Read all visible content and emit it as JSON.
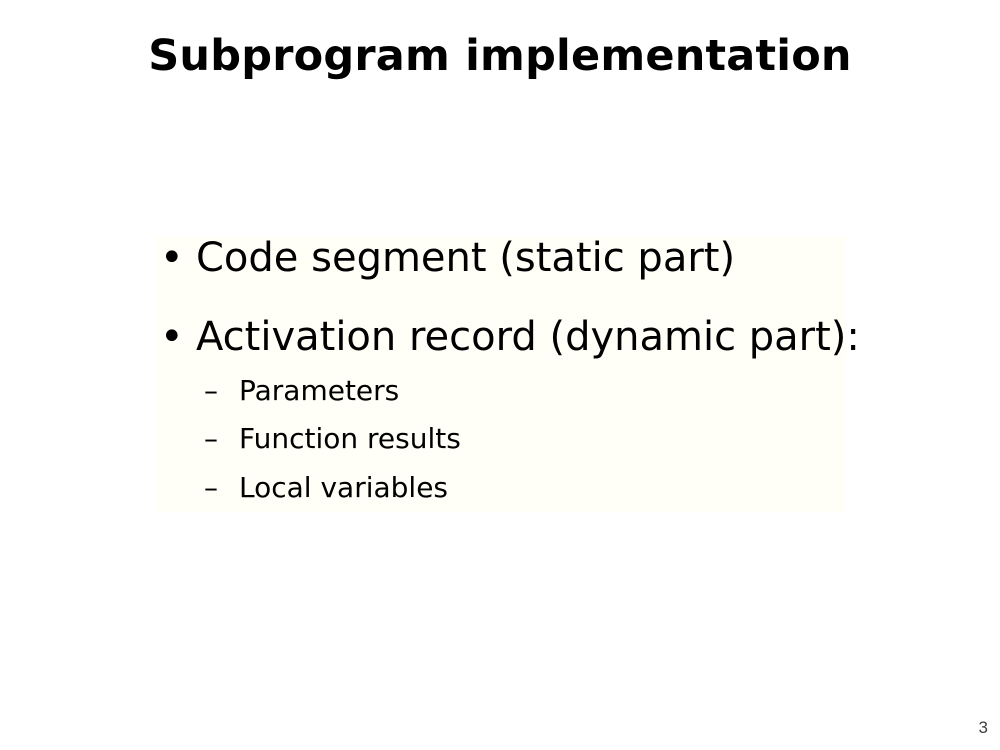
{
  "slide": {
    "title": "Subprogram implementation",
    "bullets": [
      {
        "marker": "•",
        "text": "Code segment (static part)"
      },
      {
        "marker": "•",
        "text": "Activation record (dynamic part):"
      }
    ],
    "subitems": [
      {
        "marker": "–",
        "text": "Parameters"
      },
      {
        "marker": "–",
        "text": "Function results"
      },
      {
        "marker": "–",
        "text": "Local variables"
      }
    ],
    "page_number": "3"
  }
}
